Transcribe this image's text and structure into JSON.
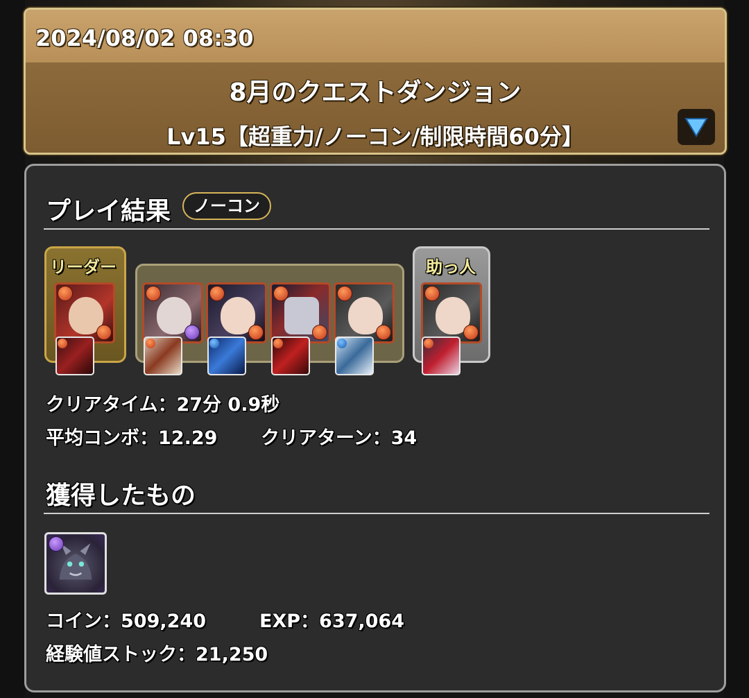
{
  "header": {
    "datetime": "2024/08/02 08:30",
    "title": "8月のクエストダンジョン",
    "subtitle": "Lv15【超重力/ノーコン/制限時間60分】",
    "expand_icon": "triangle-down-icon"
  },
  "result": {
    "section_title": "プレイ結果",
    "badge": "ノーコン",
    "leader_label": "リーダー",
    "helper_label": "助っ人",
    "clear_time": "クリアタイム：27分 0.9秒",
    "avg_combo": "平均コンボ：12.29",
    "clear_turns": "クリアターン：34"
  },
  "rewards": {
    "section_title": "獲得したもの",
    "coins": "コイン：509,240",
    "exp": "EXP：637,064",
    "exp_stock": "経験値ストック：21,250"
  },
  "colors": {
    "accent_gold": "#d8c48a",
    "panel_bg": "#2c2c2c",
    "fire_orb": "#c0361a",
    "dark_orb": "#6a3ab0"
  }
}
